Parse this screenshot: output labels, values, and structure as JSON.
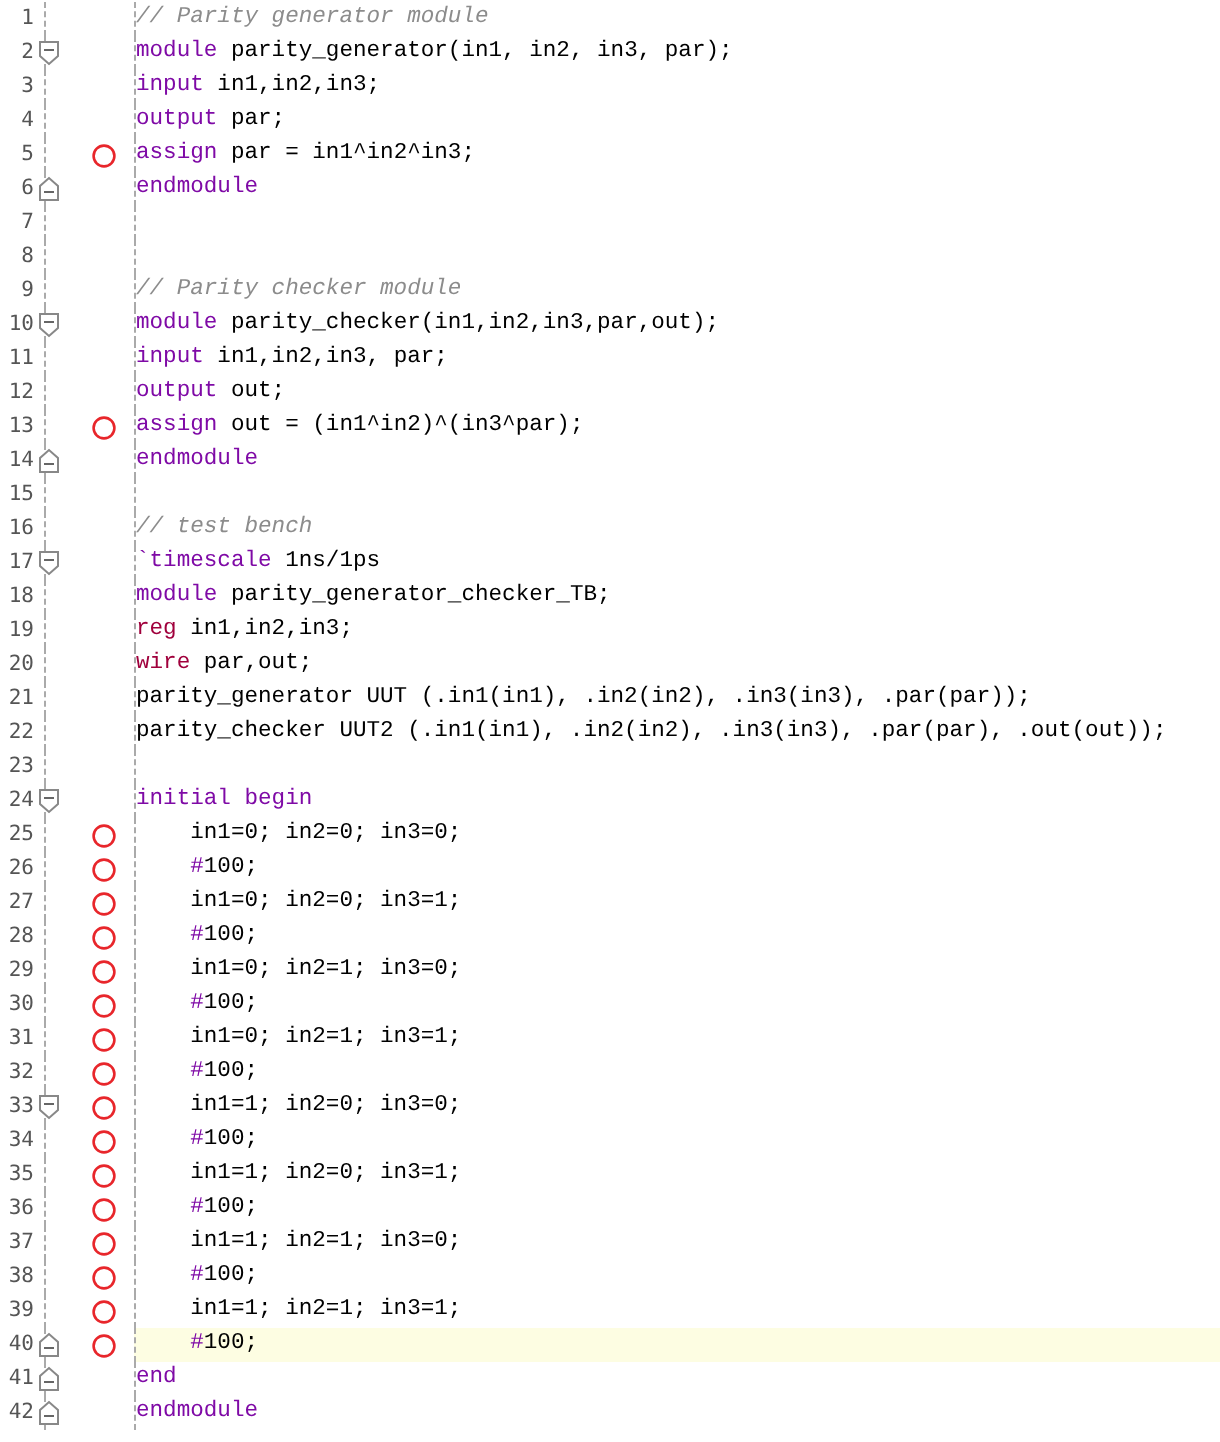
{
  "editor": {
    "lines": [
      {
        "number": "1",
        "fold_start": false,
        "fold_end": false,
        "breakpoint": false,
        "current": false,
        "tokens": [
          {
            "text": "// Parity generator module",
            "kind": "comment"
          }
        ]
      },
      {
        "number": "2",
        "fold_start": true,
        "fold_end": false,
        "breakpoint": false,
        "current": false,
        "tokens": [
          {
            "text": "module",
            "kind": "keyword"
          },
          {
            "text": " parity_generator(in1, in2, in3, par);",
            "kind": "plain"
          }
        ]
      },
      {
        "number": "3",
        "fold_start": false,
        "fold_end": false,
        "breakpoint": false,
        "current": false,
        "tokens": [
          {
            "text": "input",
            "kind": "keyword"
          },
          {
            "text": " in1,in2,in3;",
            "kind": "plain"
          }
        ]
      },
      {
        "number": "4",
        "fold_start": false,
        "fold_end": false,
        "breakpoint": false,
        "current": false,
        "tokens": [
          {
            "text": "output",
            "kind": "keyword"
          },
          {
            "text": " par;",
            "kind": "plain"
          }
        ]
      },
      {
        "number": "5",
        "fold_start": false,
        "fold_end": false,
        "breakpoint": true,
        "current": false,
        "tokens": [
          {
            "text": "assign",
            "kind": "keyword"
          },
          {
            "text": " par = in1^in2^in3;",
            "kind": "plain"
          }
        ]
      },
      {
        "number": "6",
        "fold_start": false,
        "fold_end": true,
        "breakpoint": false,
        "current": false,
        "tokens": [
          {
            "text": "endmodule",
            "kind": "keyword"
          }
        ]
      },
      {
        "number": "7",
        "fold_start": false,
        "fold_end": false,
        "breakpoint": false,
        "current": false
      },
      {
        "number": "8",
        "fold_start": false,
        "fold_end": false,
        "breakpoint": false,
        "current": false
      },
      {
        "number": "9",
        "fold_start": false,
        "fold_end": false,
        "breakpoint": false,
        "current": false,
        "tokens": [
          {
            "text": "// Parity checker module",
            "kind": "comment"
          }
        ]
      },
      {
        "number": "10",
        "fold_start": true,
        "fold_end": false,
        "breakpoint": false,
        "current": false,
        "tokens": [
          {
            "text": "module",
            "kind": "keyword"
          },
          {
            "text": " parity_checker(in1,in2,in3,par,out);",
            "kind": "plain"
          }
        ]
      },
      {
        "number": "11",
        "fold_start": false,
        "fold_end": false,
        "breakpoint": false,
        "current": false,
        "tokens": [
          {
            "text": "input",
            "kind": "keyword"
          },
          {
            "text": " in1,in2,in3, par;",
            "kind": "plain"
          }
        ]
      },
      {
        "number": "12",
        "fold_start": false,
        "fold_end": false,
        "breakpoint": false,
        "current": false,
        "tokens": [
          {
            "text": "output",
            "kind": "keyword"
          },
          {
            "text": " out;",
            "kind": "plain"
          }
        ]
      },
      {
        "number": "13",
        "fold_start": false,
        "fold_end": false,
        "breakpoint": true,
        "current": false,
        "tokens": [
          {
            "text": "assign",
            "kind": "keyword"
          },
          {
            "text": " out = (in1^in2)^(in3^par);",
            "kind": "plain"
          }
        ]
      },
      {
        "number": "14",
        "fold_start": false,
        "fold_end": true,
        "breakpoint": false,
        "current": false,
        "tokens": [
          {
            "text": "endmodule",
            "kind": "keyword"
          }
        ]
      },
      {
        "number": "15",
        "fold_start": false,
        "fold_end": false,
        "breakpoint": false,
        "current": false
      },
      {
        "number": "16",
        "fold_start": false,
        "fold_end": false,
        "breakpoint": false,
        "current": false,
        "tokens": [
          {
            "text": "// test bench",
            "kind": "comment"
          }
        ]
      },
      {
        "number": "17",
        "fold_start": true,
        "fold_end": false,
        "breakpoint": false,
        "current": false,
        "tokens": [
          {
            "text": "`timescale",
            "kind": "keyword"
          },
          {
            "text": " 1ns/1ps",
            "kind": "plain"
          }
        ]
      },
      {
        "number": "18",
        "fold_start": false,
        "fold_end": false,
        "breakpoint": false,
        "current": false,
        "tokens": [
          {
            "text": "module",
            "kind": "keyword"
          },
          {
            "text": " parity_generator_checker_TB;",
            "kind": "plain"
          }
        ]
      },
      {
        "number": "19",
        "fold_start": false,
        "fold_end": false,
        "breakpoint": false,
        "current": false,
        "tokens": [
          {
            "text": "reg",
            "kind": "type"
          },
          {
            "text": " in1,in2,in3;",
            "kind": "plain"
          }
        ]
      },
      {
        "number": "20",
        "fold_start": false,
        "fold_end": false,
        "breakpoint": false,
        "current": false,
        "tokens": [
          {
            "text": "wire",
            "kind": "type"
          },
          {
            "text": " par,out;",
            "kind": "plain"
          }
        ]
      },
      {
        "number": "21",
        "fold_start": false,
        "fold_end": false,
        "breakpoint": false,
        "current": false,
        "tokens": [
          {
            "text": "parity_generator UUT (.in1(in1), .in2(in2), .in3(in3), .par(par));",
            "kind": "plain"
          }
        ]
      },
      {
        "number": "22",
        "fold_start": false,
        "fold_end": false,
        "breakpoint": false,
        "current": false,
        "tokens": [
          {
            "text": "parity_checker UUT2 (.in1(in1), .in2(in2), .in3(in3), .par(par), .out(out));",
            "kind": "plain"
          }
        ]
      },
      {
        "number": "23",
        "fold_start": false,
        "fold_end": false,
        "breakpoint": false,
        "current": false
      },
      {
        "number": "24",
        "fold_start": true,
        "fold_end": false,
        "breakpoint": false,
        "current": false,
        "tokens": [
          {
            "text": "initial begin",
            "kind": "keyword"
          }
        ]
      },
      {
        "number": "25",
        "fold_start": false,
        "fold_end": false,
        "breakpoint": true,
        "current": false,
        "tokens": [
          {
            "text": "    in1=0; in2=0; in3=0;",
            "kind": "plain"
          }
        ]
      },
      {
        "number": "26",
        "fold_start": false,
        "fold_end": false,
        "breakpoint": true,
        "current": false,
        "tokens": [
          {
            "text": "    #",
            "kind": "keyword"
          },
          {
            "text": "100;",
            "kind": "plain"
          }
        ]
      },
      {
        "number": "27",
        "fold_start": false,
        "fold_end": false,
        "breakpoint": true,
        "current": false,
        "tokens": [
          {
            "text": "    in1=0; in2=0; in3=1;",
            "kind": "plain"
          }
        ]
      },
      {
        "number": "28",
        "fold_start": false,
        "fold_end": false,
        "breakpoint": true,
        "current": false,
        "tokens": [
          {
            "text": "    #",
            "kind": "keyword"
          },
          {
            "text": "100;",
            "kind": "plain"
          }
        ]
      },
      {
        "number": "29",
        "fold_start": false,
        "fold_end": false,
        "breakpoint": true,
        "current": false,
        "tokens": [
          {
            "text": "    in1=0; in2=1; in3=0;",
            "kind": "plain"
          }
        ]
      },
      {
        "number": "30",
        "fold_start": false,
        "fold_end": false,
        "breakpoint": true,
        "current": false,
        "tokens": [
          {
            "text": "    #",
            "kind": "keyword"
          },
          {
            "text": "100;",
            "kind": "plain"
          }
        ]
      },
      {
        "number": "31",
        "fold_start": false,
        "fold_end": false,
        "breakpoint": true,
        "current": false,
        "tokens": [
          {
            "text": "    in1=0; in2=1; in3=1;",
            "kind": "plain"
          }
        ]
      },
      {
        "number": "32",
        "fold_start": false,
        "fold_end": false,
        "breakpoint": true,
        "current": false,
        "tokens": [
          {
            "text": "    #",
            "kind": "keyword"
          },
          {
            "text": "100;",
            "kind": "plain"
          }
        ]
      },
      {
        "number": "33",
        "fold_start": true,
        "fold_end": false,
        "breakpoint": true,
        "current": false,
        "tokens": [
          {
            "text": "    in1=1; in2=0; in3=0;",
            "kind": "plain"
          }
        ]
      },
      {
        "number": "34",
        "fold_start": false,
        "fold_end": false,
        "breakpoint": true,
        "current": false,
        "tokens": [
          {
            "text": "    #",
            "kind": "keyword"
          },
          {
            "text": "100;",
            "kind": "plain"
          }
        ]
      },
      {
        "number": "35",
        "fold_start": false,
        "fold_end": false,
        "breakpoint": true,
        "current": false,
        "tokens": [
          {
            "text": "    in1=1; in2=0; in3=1;",
            "kind": "plain"
          }
        ]
      },
      {
        "number": "36",
        "fold_start": false,
        "fold_end": false,
        "breakpoint": true,
        "current": false,
        "tokens": [
          {
            "text": "    #",
            "kind": "keyword"
          },
          {
            "text": "100;",
            "kind": "plain"
          }
        ]
      },
      {
        "number": "37",
        "fold_start": false,
        "fold_end": false,
        "breakpoint": true,
        "current": false,
        "tokens": [
          {
            "text": "    in1=1; in2=1; in3=0;",
            "kind": "plain"
          }
        ]
      },
      {
        "number": "38",
        "fold_start": false,
        "fold_end": false,
        "breakpoint": true,
        "current": false,
        "tokens": [
          {
            "text": "    #",
            "kind": "keyword"
          },
          {
            "text": "100;",
            "kind": "plain"
          }
        ]
      },
      {
        "number": "39",
        "fold_start": false,
        "fold_end": false,
        "breakpoint": true,
        "current": false,
        "tokens": [
          {
            "text": "    in1=1; in2=1; in3=1;",
            "kind": "plain"
          }
        ]
      },
      {
        "number": "40",
        "fold_start": false,
        "fold_end": true,
        "breakpoint": true,
        "current": true,
        "tokens": [
          {
            "text": "    #",
            "kind": "keyword"
          },
          {
            "text": "100;",
            "kind": "plain"
          }
        ]
      },
      {
        "number": "41",
        "fold_start": false,
        "fold_end": true,
        "breakpoint": false,
        "current": false,
        "tokens": [
          {
            "text": "end",
            "kind": "keyword"
          }
        ]
      },
      {
        "number": "42",
        "fold_start": false,
        "fold_end": true,
        "breakpoint": false,
        "current": false,
        "tokens": [
          {
            "text": "endmodule",
            "kind": "keyword"
          }
        ]
      }
    ]
  }
}
